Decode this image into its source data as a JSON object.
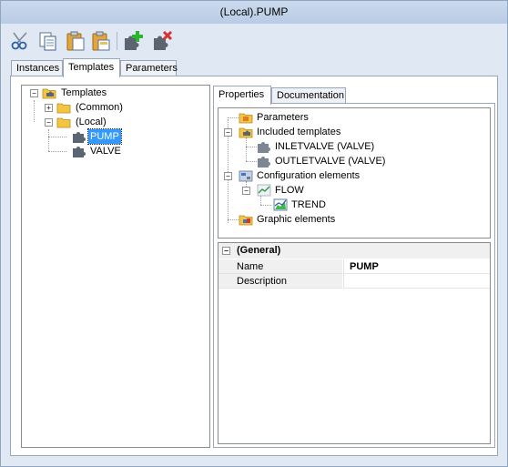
{
  "window": {
    "title": "(Local).PUMP"
  },
  "toolbar": {
    "buttons": [
      {
        "icon": "cut-icon"
      },
      {
        "icon": "copy-icon"
      },
      {
        "icon": "paste-icon"
      },
      {
        "icon": "paste-special-icon"
      },
      {
        "icon": "add-template-icon"
      },
      {
        "icon": "delete-template-icon"
      }
    ]
  },
  "tabs": [
    {
      "label": "Instances",
      "active": false
    },
    {
      "label": "Templates",
      "active": true
    },
    {
      "label": "Parameters",
      "active": false
    }
  ],
  "template_tree": {
    "root": "Templates",
    "common": "(Common)",
    "local": "(Local)",
    "pump": "PUMP",
    "valve": "VALVE"
  },
  "right_tabs": [
    {
      "label": "Properties",
      "active": true
    },
    {
      "label": "Documentation",
      "active": false
    }
  ],
  "properties_tree": {
    "parameters": "Parameters",
    "included_templates": "Included templates",
    "inletvalve": "INLETVALVE (VALVE)",
    "outletvalve": "OUTLETVALVE (VALVE)",
    "configuration_elements": "Configuration elements",
    "flow": "FLOW",
    "trend": "TREND",
    "graphic_elements": "Graphic elements"
  },
  "property_grid": {
    "category": "(General)",
    "rows": [
      {
        "name": "Name",
        "value": "PUMP"
      },
      {
        "name": "Description",
        "value": ""
      }
    ]
  },
  "colors": {
    "selection": "#3399ff",
    "folder": "#f5c542",
    "puzzle": "#5a6573",
    "add_accent": "#2db52d",
    "delete_accent": "#d93030"
  }
}
